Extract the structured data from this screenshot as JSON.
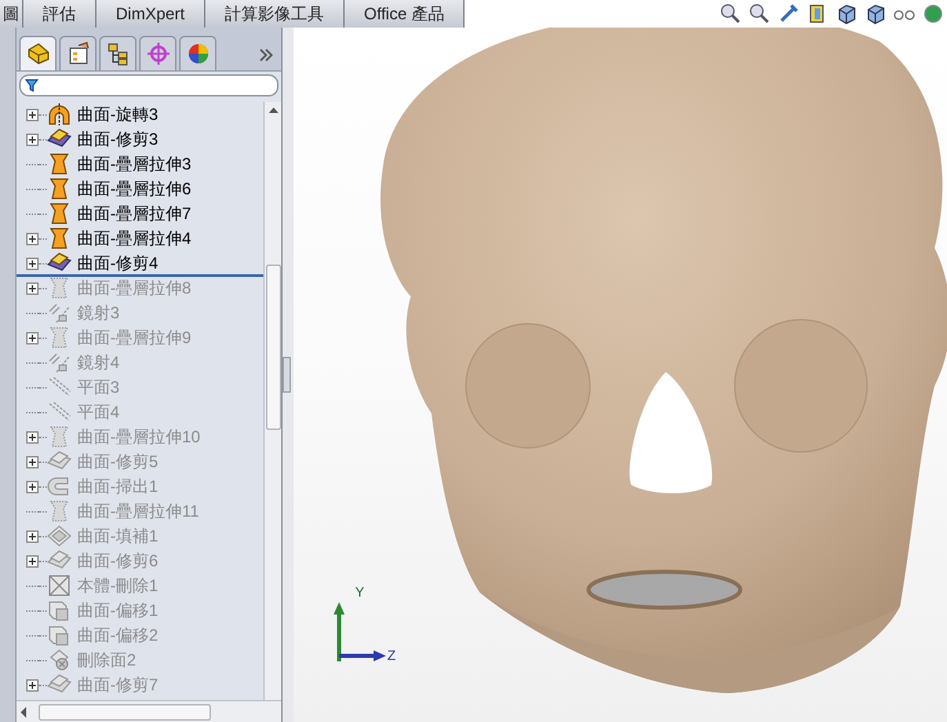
{
  "command_tabs": [
    {
      "label": "圖"
    },
    {
      "label": "評估"
    },
    {
      "label": "DimXpert"
    },
    {
      "label": "計算影像工具"
    },
    {
      "label": "Office 產品"
    }
  ],
  "panel_tabs": [
    {
      "kind": "features",
      "selected": true
    },
    {
      "kind": "properties",
      "selected": false
    },
    {
      "kind": "configurations",
      "selected": false
    },
    {
      "kind": "target",
      "selected": false
    },
    {
      "kind": "appearance",
      "selected": false
    }
  ],
  "tree": {
    "items": [
      {
        "label": "曲面-旋轉3",
        "kind": "revolve",
        "expandable": true,
        "suppressed": false
      },
      {
        "label": "曲面-修剪3",
        "kind": "trim",
        "expandable": true,
        "suppressed": false
      },
      {
        "label": "曲面-疊層拉伸3",
        "kind": "loft",
        "expandable": false,
        "suppressed": false
      },
      {
        "label": "曲面-疊層拉伸6",
        "kind": "loft",
        "expandable": false,
        "suppressed": false
      },
      {
        "label": "曲面-疊層拉伸7",
        "kind": "loft",
        "expandable": false,
        "suppressed": false
      },
      {
        "label": "曲面-疊層拉伸4",
        "kind": "loft",
        "expandable": true,
        "suppressed": false
      },
      {
        "label": "曲面-修剪4",
        "kind": "trim",
        "expandable": true,
        "suppressed": false
      },
      {
        "label": "曲面-疊層拉伸8",
        "kind": "loft",
        "expandable": true,
        "suppressed": true
      },
      {
        "label": "鏡射3",
        "kind": "mirror",
        "expandable": false,
        "suppressed": true
      },
      {
        "label": "曲面-疊層拉伸9",
        "kind": "loft",
        "expandable": true,
        "suppressed": true
      },
      {
        "label": "鏡射4",
        "kind": "mirror",
        "expandable": false,
        "suppressed": true
      },
      {
        "label": "平面3",
        "kind": "plane",
        "expandable": false,
        "suppressed": true
      },
      {
        "label": "平面4",
        "kind": "plane",
        "expandable": false,
        "suppressed": true
      },
      {
        "label": "曲面-疊層拉伸10",
        "kind": "loft",
        "expandable": true,
        "suppressed": true
      },
      {
        "label": "曲面-修剪5",
        "kind": "trim",
        "expandable": true,
        "suppressed": true
      },
      {
        "label": "曲面-掃出1",
        "kind": "sweep",
        "expandable": true,
        "suppressed": true
      },
      {
        "label": "曲面-疊層拉伸11",
        "kind": "loft",
        "expandable": false,
        "suppressed": true
      },
      {
        "label": "曲面-填補1",
        "kind": "fill",
        "expandable": true,
        "suppressed": true
      },
      {
        "label": "曲面-修剪6",
        "kind": "trim",
        "expandable": true,
        "suppressed": true
      },
      {
        "label": "本體-刪除1",
        "kind": "delete-body",
        "expandable": false,
        "suppressed": true
      },
      {
        "label": "曲面-偏移1",
        "kind": "offset",
        "expandable": false,
        "suppressed": true
      },
      {
        "label": "曲面-偏移2",
        "kind": "offset",
        "expandable": false,
        "suppressed": true
      },
      {
        "label": "刪除面2",
        "kind": "delete-face",
        "expandable": false,
        "suppressed": true
      },
      {
        "label": "曲面-修剪7",
        "kind": "trim",
        "expandable": true,
        "suppressed": true
      }
    ]
  },
  "viewport": {
    "triad": {
      "y_label": "Y",
      "z_label": "Z"
    }
  }
}
